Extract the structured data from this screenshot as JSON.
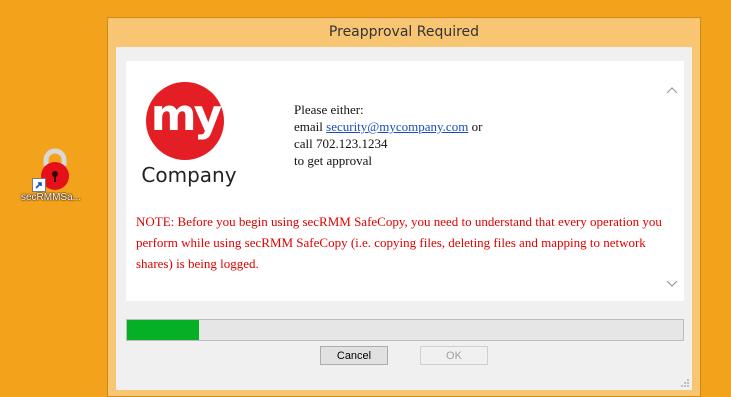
{
  "desktop": {
    "icon_label": "secRMMSa..."
  },
  "window": {
    "title": "Preapproval Required"
  },
  "logo": {
    "mark_text": "my",
    "company_text": "Company",
    "color": "#e31e24"
  },
  "message": {
    "line1": "Please either:",
    "email_prefix": "email ",
    "email_link": "security@mycompany.com",
    "email_suffix": " or",
    "call_line": "call 702.123.1234",
    "approval_line": "to get approval"
  },
  "note": {
    "text": "NOTE:  Before you begin using secRMM SafeCopy, you need to understand that every operation you perform while using secRMM SafeCopy (i.e. copying files, deleting files and mapping to network shares) is being logged."
  },
  "progress": {
    "value_percent": 13,
    "color": "#06b025"
  },
  "buttons": {
    "cancel_label": "Cancel",
    "ok_label": "OK"
  },
  "icons": [
    "lock-icon",
    "shortcut-arrow-icon",
    "scroll-up-icon",
    "scroll-down-icon",
    "resize-grip-icon"
  ]
}
